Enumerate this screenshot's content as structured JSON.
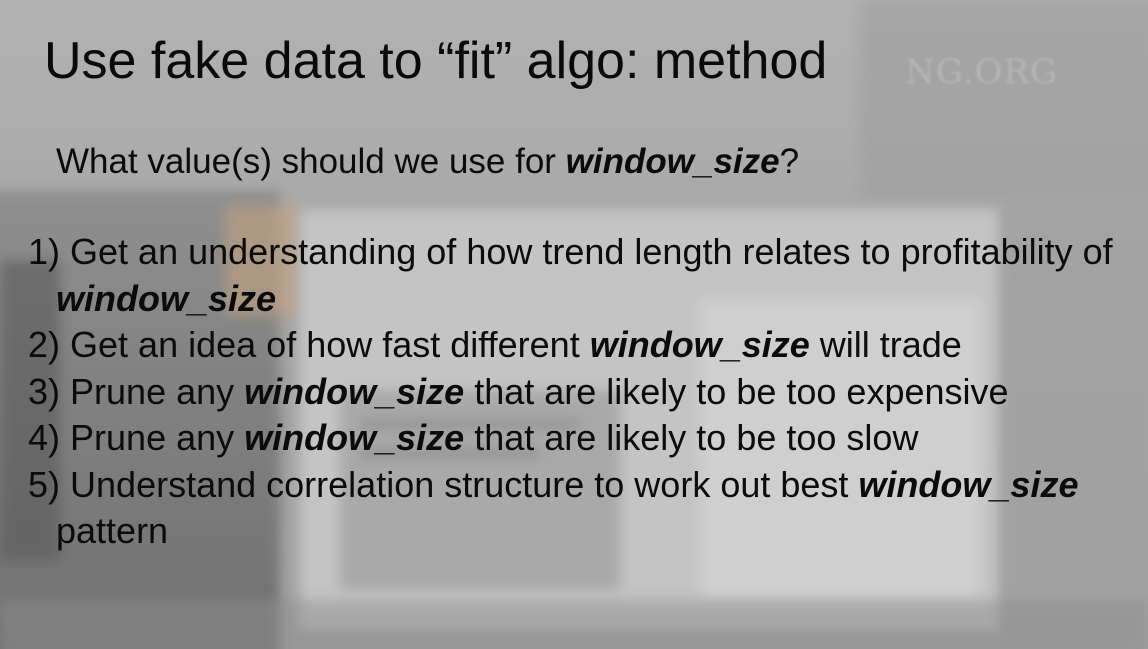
{
  "slide": {
    "title": "Use fake data to “fit” algo: method",
    "question": {
      "before": "What value(s) should we use for ",
      "keyword": "window_size",
      "after": "?"
    },
    "steps": [
      {
        "number": "1)",
        "before": "Get an understanding of how trend length relates to profitability of ",
        "keyword": "window_size",
        "after": ""
      },
      {
        "number": "2)",
        "before": "Get an idea of how fast different ",
        "keyword": "window_size",
        "after": " will trade"
      },
      {
        "number": "3)",
        "before": "Prune any ",
        "keyword": "window_size",
        "after": " that are likely to be too expensive"
      },
      {
        "number": "4)",
        "before": "Prune any ",
        "keyword": "window_size",
        "after": " that are likely to be too slow"
      },
      {
        "number": "5)",
        "before": "Understand correlation structure to work out best ",
        "keyword": "window_size",
        "after": " pattern"
      }
    ]
  },
  "background": {
    "watermark_text": "NG.ORG"
  }
}
